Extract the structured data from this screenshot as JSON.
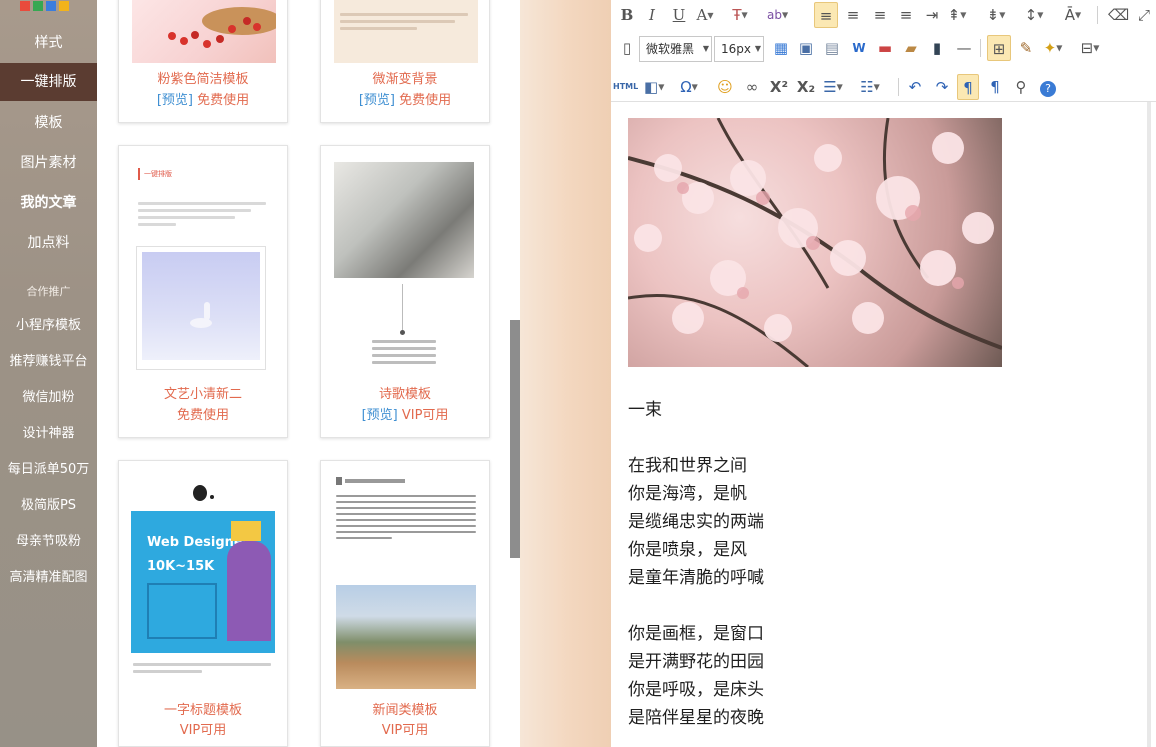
{
  "sidebar": {
    "items": [
      {
        "label": "样式"
      },
      {
        "label": "一键排版"
      },
      {
        "label": "模板"
      },
      {
        "label": "图片素材"
      },
      {
        "label": "我的文章"
      },
      {
        "label": "加点料"
      },
      {
        "label": "合作推广"
      },
      {
        "label": "小程序模板"
      },
      {
        "label": "推荐赚钱平台"
      },
      {
        "label": "微信加粉"
      },
      {
        "label": "设计神器"
      },
      {
        "label": "每日派单50万"
      },
      {
        "label": "极简版PS"
      },
      {
        "label": "母亲节吸粉"
      },
      {
        "label": "高清精准配图"
      }
    ]
  },
  "templates": {
    "cards": [
      {
        "name": "粉紫色简洁模板",
        "preview": "[预览]",
        "action": "免费使用"
      },
      {
        "name": "微渐变背景",
        "preview": "[预览]",
        "action": "免费使用"
      },
      {
        "name": "文艺小清新二",
        "preview": "",
        "action": "免费使用"
      },
      {
        "name": "诗歌模板",
        "preview": "[预览]",
        "action": "VIP可用"
      },
      {
        "name": "一字标题模板",
        "preview": "",
        "action": "VIP可用"
      },
      {
        "name": "新闻类模板",
        "preview": "",
        "action": "VIP可用"
      }
    ],
    "thumb_texts": {
      "yijian_title": "一键排版",
      "web_designer": "Web Designer",
      "salary": "10K~15K"
    }
  },
  "toolbar": {
    "font_family": "微软雅黑",
    "font_size": "16px",
    "html_label": "HTML"
  },
  "editor": {
    "title": "一束",
    "stanza1": [
      "在我和世界之间",
      "你是海湾，是帆",
      "是缆绳忠实的两端",
      "你是喷泉，是风",
      "是童年清脆的呼喊"
    ],
    "stanza2": [
      "你是画框，是窗口",
      "是开满野花的田园",
      "你是呼吸，是床头",
      "是陪伴星星的夜晚"
    ]
  },
  "colors": {
    "accent_active": "#5b3c31",
    "template_name": "#e26a4e",
    "preview_link": "#3f8fd2"
  }
}
